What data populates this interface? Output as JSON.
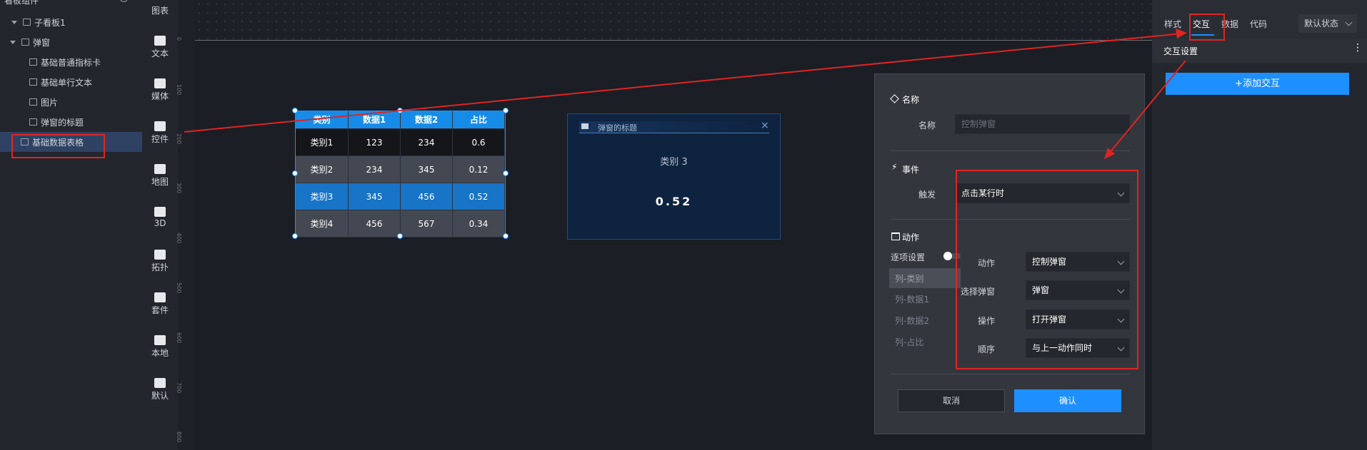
{
  "tree": {
    "top_label": "看板组件",
    "items": [
      {
        "label": "子看板1",
        "icon": "monitor-icon"
      },
      {
        "label": "弹窗",
        "icon": "popup-icon"
      },
      {
        "label": "基础普通指标卡",
        "icon": "metric-card-icon"
      },
      {
        "label": "基础单行文本",
        "icon": "text-icon"
      },
      {
        "label": "图片",
        "icon": "image-icon"
      },
      {
        "label": "弹窗的标题",
        "icon": "text-icon"
      },
      {
        "label": "基础数据表格",
        "icon": "table-icon"
      }
    ]
  },
  "toolbar": {
    "items": [
      "图表",
      "文本",
      "媒体",
      "控件",
      "地图",
      "3D",
      "拓扑",
      "套件",
      "本地",
      "默认"
    ]
  },
  "ruler": {
    "ticks": [
      "0",
      "100",
      "200",
      "300",
      "400",
      "500",
      "600",
      "700",
      "800"
    ]
  },
  "table_widget": {
    "headers": [
      "类别",
      "数据1",
      "数据2",
      "占比"
    ],
    "rows": [
      [
        "类别1",
        "123",
        "234",
        "0.6"
      ],
      [
        "类别2",
        "234",
        "345",
        "0.12"
      ],
      [
        "类别3",
        "345",
        "456",
        "0.52"
      ],
      [
        "类别4",
        "456",
        "567",
        "0.34"
      ]
    ]
  },
  "popup_widget": {
    "title": "弹窗的标题",
    "category": "类别 3",
    "value": "0.52"
  },
  "dialog": {
    "name_section": "名称",
    "name_label": "名称",
    "name_placeholder": "控制弹窗",
    "event_section": "事件",
    "trigger_label": "触发",
    "trigger_value": "点击某行时",
    "action_section": "动作",
    "per_item_label": "逐项设置",
    "columns": [
      "列-类别",
      "列-数据1",
      "列-数据2",
      "列-占比"
    ],
    "action_label": "动作",
    "action_value": "控制弹窗",
    "select_popup_label": "选择弹窗",
    "select_popup_value": "弹窗",
    "operation_label": "操作",
    "operation_value": "打开弹窗",
    "order_label": "顺序",
    "order_value": "与上一动作同时",
    "cancel_label": "取消",
    "confirm_label": "确认"
  },
  "right_panel": {
    "tabs": [
      "样式",
      "交互",
      "数据",
      "代码"
    ],
    "state_select": "默认状态",
    "section_title": "交互设置",
    "add_button": "+添加交互"
  },
  "colors": {
    "accent": "#1e8fff",
    "annotation": "#e02424",
    "header": "#168ce8"
  }
}
